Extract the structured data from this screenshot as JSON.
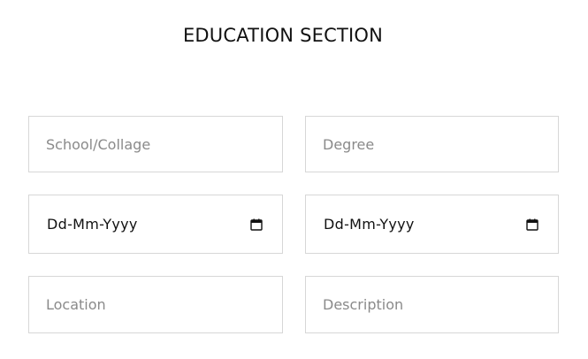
{
  "section": {
    "title": "EDUCATION SECTION"
  },
  "form": {
    "school_placeholder": "School/Collage",
    "degree_placeholder": "Degree",
    "start_date_display": "Dd-Mm-Yyyy",
    "end_date_display": "Dd-Mm-Yyyy",
    "location_placeholder": "Location",
    "description_placeholder": "Description"
  },
  "icons": {
    "date_picker": "calendar-icon"
  },
  "colors": {
    "border": "#d7d7d7",
    "placeholder": "#8a8a8a",
    "text": "#111111"
  }
}
